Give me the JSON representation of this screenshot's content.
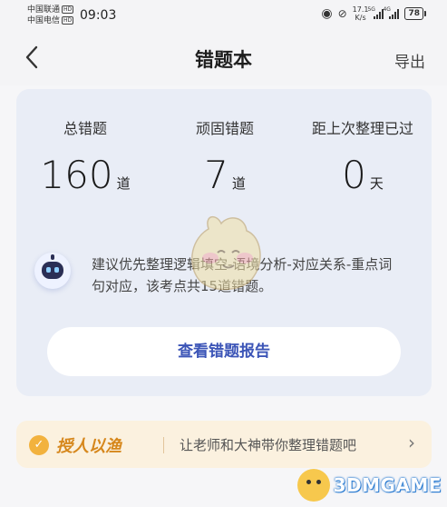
{
  "status_bar": {
    "carrier_1": "中国联通",
    "carrier_2": "中国电信",
    "hd_badge": "HD",
    "time": "09:03",
    "net_speed_value": "17.1",
    "net_speed_unit": "K/s",
    "signal_1_tag": "5G",
    "signal_2_tag": "4G",
    "battery": "78"
  },
  "header": {
    "title": "错题本",
    "export_label": "导出"
  },
  "stats": [
    {
      "label": "总错题",
      "value": "160",
      "unit": "道"
    },
    {
      "label": "顽固错题",
      "value": "7",
      "unit": "道"
    },
    {
      "label": "距上次整理已过",
      "value": "0",
      "unit": "天"
    }
  ],
  "suggestion": "建议优先整理逻辑填空-语境分析-对应关系-重点词句对应，该考点共15道错题。",
  "report_button_label": "查看错题报告",
  "tip": {
    "title": "授人以渔",
    "text": "让老师和大神带你整理错题吧",
    "arrow": "›"
  },
  "watermark": "3DMGAME",
  "colors": {
    "accent": "#3c55b7",
    "card_bg": "#e9edf6",
    "tip_bg": "#fbf1df",
    "tip_title": "#d6871c"
  }
}
